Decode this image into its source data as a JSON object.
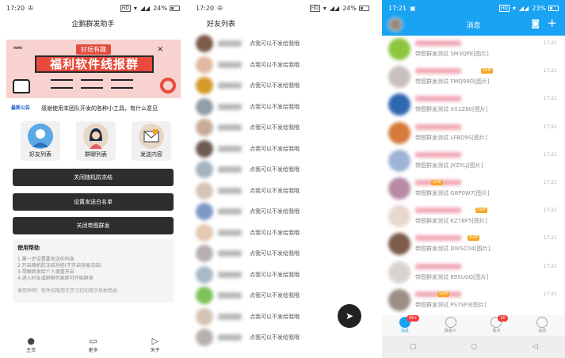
{
  "panel1": {
    "status": {
      "time": "17:20",
      "battery": "24%"
    },
    "title": "企鹅群发助手",
    "banner": {
      "tag": "好玩有趣",
      "headline": "福利软件线报群"
    },
    "notice": {
      "label": "最新公告",
      "text": "感谢使用本团队开发的各种小工具，有什么意见"
    },
    "tiles": [
      {
        "label": "好友列表",
        "icon": "user-icon",
        "color": "#5aa9e6"
      },
      {
        "label": "群聊列表",
        "icon": "woman-icon",
        "color": "#e7d7c6"
      },
      {
        "label": "发送内容",
        "icon": "envelope-icon",
        "color": "#e7d7c6"
      }
    ],
    "buttons": [
      "关闭随机防冻结",
      "设置发送白名单",
      "关闭带图群发"
    ],
    "help": {
      "title": "使用帮助",
      "lines": [
        "1.第一步设置要发送的内容",
        "2.开启随机防冻结功能(不开启容易冻结)",
        "3.带图群发给个人慎重开启",
        "4.进入好友或群聊列表即可开始群发"
      ],
      "note": "使用声明：软件仅限用于学习切勿用于其他用途"
    },
    "nav": [
      {
        "label": "主页",
        "icon": "home-icon"
      },
      {
        "label": "更多",
        "icon": "box-icon"
      },
      {
        "label": "关于",
        "icon": "triangle-icon"
      }
    ]
  },
  "panel2": {
    "status": {
      "time": "17:20",
      "battery": "24%"
    },
    "title": "好友列表",
    "rows": [
      {
        "text": "点我可以不发给我哦",
        "color": "#7b5b4a"
      },
      {
        "text": "点我可以不发给我哦",
        "color": "#e2b9a0"
      },
      {
        "text": "点我可以不发给我哦",
        "color": "#d49a2a"
      },
      {
        "text": "点我可以不发给我哦",
        "color": "#8f9ea7"
      },
      {
        "text": "点我可以不发给我哦",
        "color": "#c7ab98"
      },
      {
        "text": "点我可以不发给我哦",
        "color": "#6e5a50"
      },
      {
        "text": "点我可以不发给我哦",
        "color": "#a4b3be"
      },
      {
        "text": "点我可以不发给我哦",
        "color": "#d7c4b5"
      },
      {
        "text": "点我可以不发给我哦",
        "color": "#7f98c9"
      },
      {
        "text": "点我可以不发给我哦",
        "color": "#e4c9b3"
      },
      {
        "text": "点我可以不发给我哦",
        "color": "#b6aeb0"
      },
      {
        "text": "点我可以不发给我哦",
        "color": "#a9b9c6"
      },
      {
        "text": "点我可以不发给我哦",
        "color": "#7dc35b"
      },
      {
        "text": "点我可以不发给我哦",
        "color": "#d6c3b3"
      },
      {
        "text": "点我可以不发给我哦",
        "color": "#b8b0ad"
      }
    ],
    "fab_icon": "send-icon"
  },
  "panel3": {
    "status": {
      "time": "17:21",
      "battery": "23%"
    },
    "title": "消息",
    "rows": [
      {
        "msg": "带图群发测试 SM3QPE[图片]",
        "time": "17:21",
        "color": "#8cc63f"
      },
      {
        "msg": "带图群发测试 FMQ99D[图片]",
        "time": "17:21",
        "color": "#c8c0bc"
      },
      {
        "msg": "带图群发测试 XX1Z80[图片]",
        "time": "17:21",
        "color": "#2f67b0"
      },
      {
        "msg": "带图群发测试 LFBD9S[图片]",
        "time": "17:21",
        "color": "#d67a3c"
      },
      {
        "msg": "带图群发测试 JXZYLJ[图片]",
        "time": "17:21",
        "color": "#9fb3d8"
      },
      {
        "msg": "带图群发测试 G8P0W7[图片]",
        "time": "17:21",
        "color": "#b88aa3"
      },
      {
        "msg": "带图群发测试 KZ7BF5[图片]",
        "time": "17:21",
        "color": "#e8d7cc"
      },
      {
        "msg": "带图群发测试 DWSC04[图片]",
        "time": "17:21",
        "color": "#7e5b4b"
      },
      {
        "msg": "带图群发测试 89XU0Q[图片]",
        "time": "17:21",
        "color": "#d9d3d0"
      },
      {
        "msg": "带图群发测试 PS7SF9[图片]",
        "time": "17:21",
        "color": "#9c8d86"
      }
    ],
    "tabs": [
      {
        "label": "消息",
        "badge": "99+",
        "active": true
      },
      {
        "label": "联系人",
        "badge": "",
        "active": false
      },
      {
        "label": "看点",
        "badge": "10",
        "active": false
      },
      {
        "label": "动态",
        "badge": "",
        "active": false
      }
    ]
  }
}
